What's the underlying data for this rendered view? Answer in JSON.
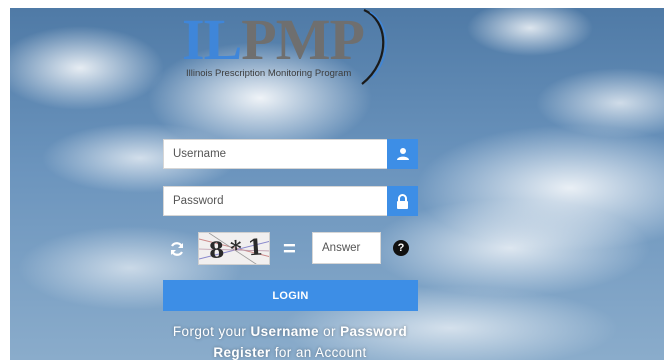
{
  "logo": {
    "brand_il": "IL",
    "brand_pmp": "PMP",
    "subtitle": "Illinois Prescription Monitoring Program"
  },
  "form": {
    "username_placeholder": "Username",
    "password_placeholder": "Password",
    "captcha_text": "8*1",
    "equals": "=",
    "answer_placeholder": "Answer",
    "help": "?",
    "login_label": "LOGIN"
  },
  "links": {
    "forgot_prefix": "Forgot your",
    "username_link": "Username",
    "or": "or",
    "password_link": "Password",
    "register_link": "Register",
    "register_suffix": "for an Account"
  },
  "icons": {
    "username_addon": "user-icon",
    "password_addon": "lock-icon",
    "captcha_refresh": "refresh-icon",
    "captcha_help": "help-icon"
  },
  "colors": {
    "accent": "#3d8ee6",
    "brand_blue": "#3f86d9",
    "brand_gray": "#6f6f6f"
  }
}
